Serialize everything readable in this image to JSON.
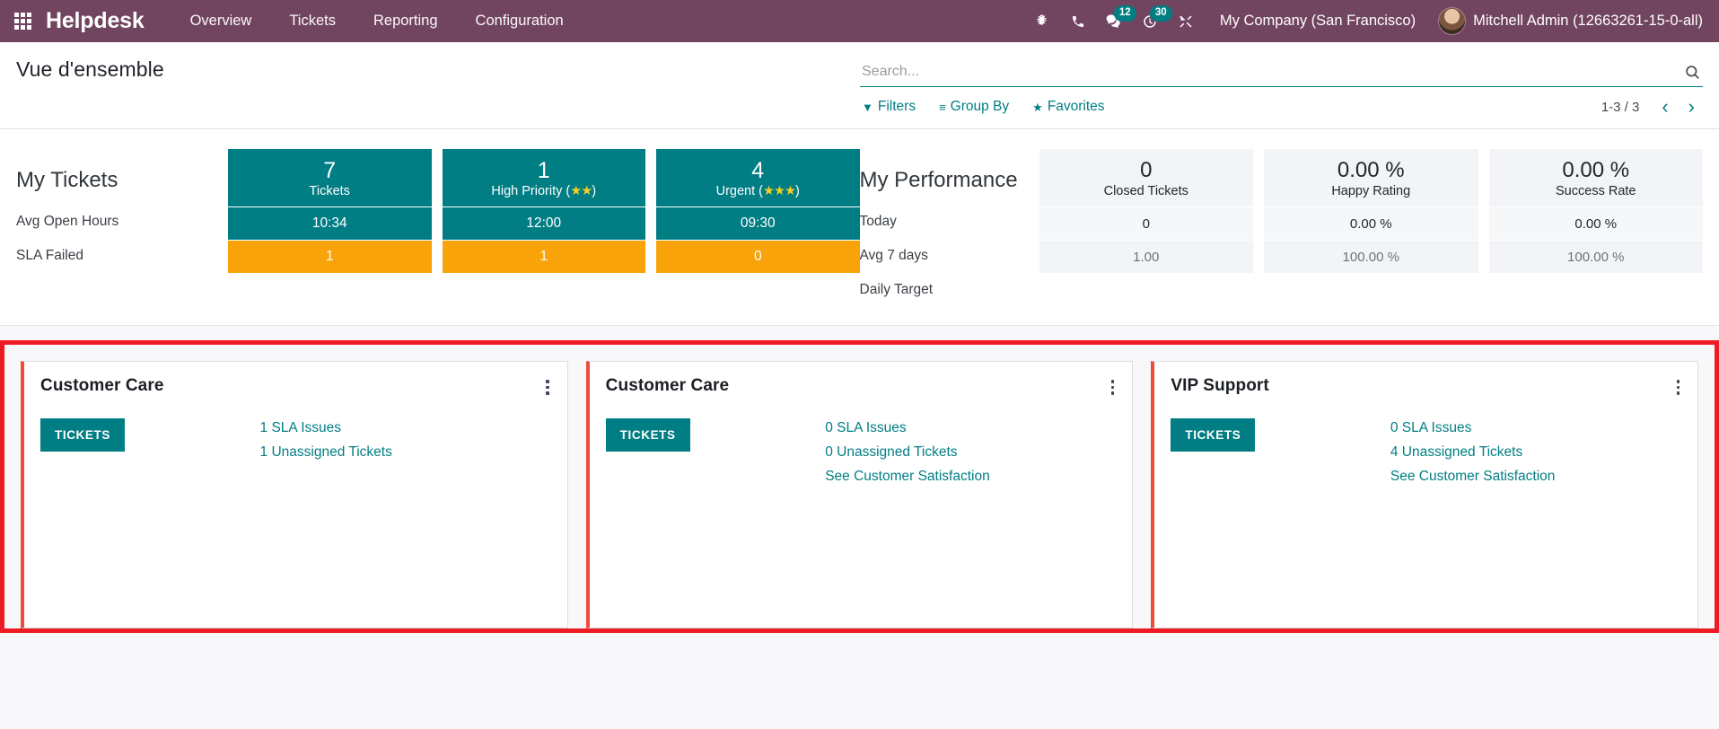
{
  "navbar": {
    "apps_icon": "apps-grid-icon",
    "brand": "Helpdesk",
    "menu": [
      {
        "label": "Overview"
      },
      {
        "label": "Tickets"
      },
      {
        "label": "Reporting"
      },
      {
        "label": "Configuration"
      }
    ],
    "sys_icons": [
      {
        "name": "bug-icon",
        "badge": ""
      },
      {
        "name": "phone-icon",
        "badge": ""
      },
      {
        "name": "messages-icon",
        "badge": "12"
      },
      {
        "name": "activity-clock-icon",
        "badge": "30"
      },
      {
        "name": "tools-icon",
        "badge": ""
      }
    ],
    "company": "My Company (San Francisco)",
    "user": "Mitchell Admin (12663261-15-0-all)",
    "bg_color": "#71445f",
    "badge_color": "#017e84"
  },
  "control_panel": {
    "title": "Vue d'ensemble",
    "search": {
      "value": "",
      "placeholder": "Search..."
    },
    "filters_label": "Filters",
    "groupby_label": "Group By",
    "favorites_label": "Favorites",
    "pager": "1-3 / 3",
    "prev_arrow": "‹",
    "next_arrow": "›"
  },
  "my_tickets": {
    "title": "My Tickets",
    "row_labels": [
      "Avg Open Hours",
      "SLA Failed"
    ],
    "columns": [
      {
        "value": "7",
        "label": "Tickets",
        "stars": 0,
        "avg_open_hours": "10:34",
        "sla_failed": "1"
      },
      {
        "value": "1",
        "label": "High Priority",
        "stars": 2,
        "avg_open_hours": "12:00",
        "sla_failed": "1"
      },
      {
        "value": "4",
        "label": "Urgent",
        "stars": 3,
        "avg_open_hours": "09:30",
        "sla_failed": "0"
      }
    ],
    "accent_color": "#017e84",
    "warning_color": "#f8a30a"
  },
  "my_performance": {
    "title": "My Performance",
    "row_labels": [
      "Today",
      "Avg 7 days",
      "Daily Target"
    ],
    "columns": [
      {
        "value": "0",
        "label": "Closed Tickets",
        "avg_7_days": "0",
        "daily_target": "1.00"
      },
      {
        "value": "0.00 %",
        "label": "Happy Rating",
        "avg_7_days": "0.00 %",
        "daily_target": "100.00 %"
      },
      {
        "value": "0.00 %",
        "label": "Success Rate",
        "avg_7_days": "0.00 %",
        "daily_target": "100.00 %"
      }
    ]
  },
  "teams": {
    "highlight_color": "#ed1c24",
    "cards": [
      {
        "name": "Customer Care",
        "button": "TICKETS",
        "links": [
          "1 SLA Issues",
          "1 Unassigned Tickets"
        ]
      },
      {
        "name": "Customer Care",
        "button": "TICKETS",
        "links": [
          "0 SLA Issues",
          "0 Unassigned Tickets",
          "See Customer Satisfaction"
        ]
      },
      {
        "name": "VIP Support",
        "button": "TICKETS",
        "links": [
          "0 SLA Issues",
          "4 Unassigned Tickets",
          "See Customer Satisfaction"
        ]
      }
    ]
  }
}
